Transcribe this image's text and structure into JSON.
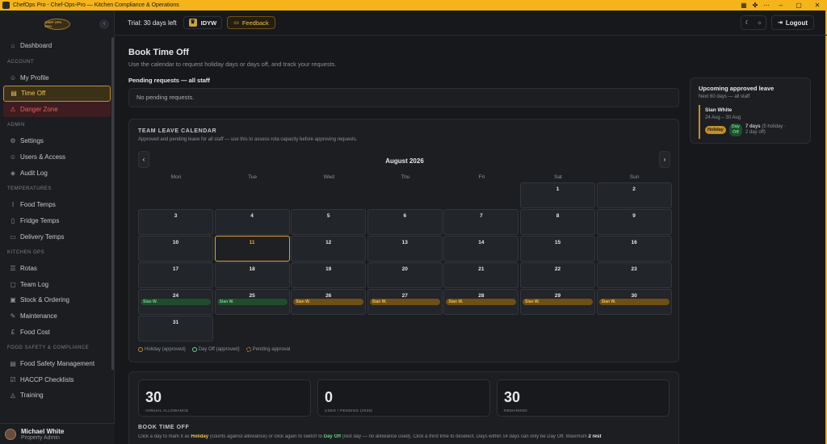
{
  "window": {
    "title": "ChefOps Pro - Chef-Ops-Pro — Kitchen Compliance & Operations"
  },
  "sidebar": {
    "logo_text": "CHEF OPS PRO",
    "collapse_icon": "chevron-left-icon",
    "dashboard": "Dashboard",
    "sections": {
      "account": "ACCOUNT",
      "admin": "ADMIN",
      "temperatures": "TEMPERATURES",
      "kitchen_ops": "KITCHEN OPS",
      "food_safety": "FOOD SAFETY & COMPLIANCE"
    },
    "items": {
      "my_profile": "My Profile",
      "time_off": "Time Off",
      "danger_zone": "Danger Zone",
      "settings": "Settings",
      "users_access": "Users & Access",
      "audit_log": "Audit Log",
      "food_temps": "Food Temps",
      "fridge_temps": "Fridge Temps",
      "delivery_temps": "Delivery Temps",
      "rotas": "Rotas",
      "team_log": "Team Log",
      "stock_ordering": "Stock & Ordering",
      "maintenance": "Maintenance",
      "food_cost": "Food Cost",
      "food_safety_mgmt": "Food Safety Management",
      "haccp": "HACCP Checklists",
      "training": "Training"
    },
    "user": {
      "name": "Michael White",
      "role": "Property Admin"
    }
  },
  "topbar": {
    "trial": "Trial: 30 days left",
    "org": "IDYW",
    "feedback": "Feedback",
    "logout": "Logout"
  },
  "page": {
    "title": "Book Time Off",
    "subtitle": "Use the calendar to request holiday days or days off, and track your requests.",
    "pending_heading": "Pending requests — all staff",
    "pending_empty": "No pending requests."
  },
  "upcoming": {
    "title": "Upcoming approved leave",
    "subtitle": "Next 60 days — all staff",
    "entry": {
      "name": "Sian White",
      "dates": "24 Aug – 30 Aug",
      "holiday": "Holiday",
      "dayoff_1": "Day",
      "dayoff_2": "Off",
      "days_bold": "7 days",
      "days_rest_1": " (5 holiday ·",
      "days_rest_2": "2 day off)"
    }
  },
  "calendar": {
    "title": "TEAM LEAVE CALENDAR",
    "description": "Approved and pending leave for all staff — use this to assess rota capacity before approving requests.",
    "month": "August 2026",
    "weekdays": [
      "Mon",
      "Tue",
      "Wed",
      "Thu",
      "Fri",
      "Sat",
      "Sun"
    ],
    "today": 11,
    "events": {
      "24": {
        "label": "Sian W.",
        "type": "off"
      },
      "25": {
        "label": "Sian W.",
        "type": "off"
      },
      "26": {
        "label": "Sian W.",
        "type": "pend"
      },
      "27": {
        "label": "Sian W.",
        "type": "pend"
      },
      "28": {
        "label": "Sian W.",
        "type": "pend"
      },
      "29": {
        "label": "Sian W.",
        "type": "pend"
      },
      "30": {
        "label": "Sian W.",
        "type": "pend"
      }
    },
    "legend": {
      "holiday": "Holiday (approved)",
      "dayoff": "Day Off (approved)",
      "pending": "Pending approval"
    }
  },
  "stats": [
    {
      "value": "30",
      "label": "ANNUAL ALLOWANCE"
    },
    {
      "value": "0",
      "label": "USED / PENDING (2026)"
    },
    {
      "value": "30",
      "label": "REMAINING"
    }
  ],
  "book": {
    "title": "BOOK TIME OFF",
    "d1": "Click a day to mark it as ",
    "holiday": "Holiday",
    "d2": " (counts against allowance) or click again to switch to ",
    "dayoff": "Day Off",
    "d3": " (rest day — no allowance used). Click a third time to deselect. Days within 14 days can only be Day Off. Maximum ",
    "max": "2 rest"
  },
  "colors": {
    "accent": "#f4b41a",
    "holiday": "#c58f22",
    "dayoff": "#6fd08b",
    "danger": "#ef5b5b"
  }
}
